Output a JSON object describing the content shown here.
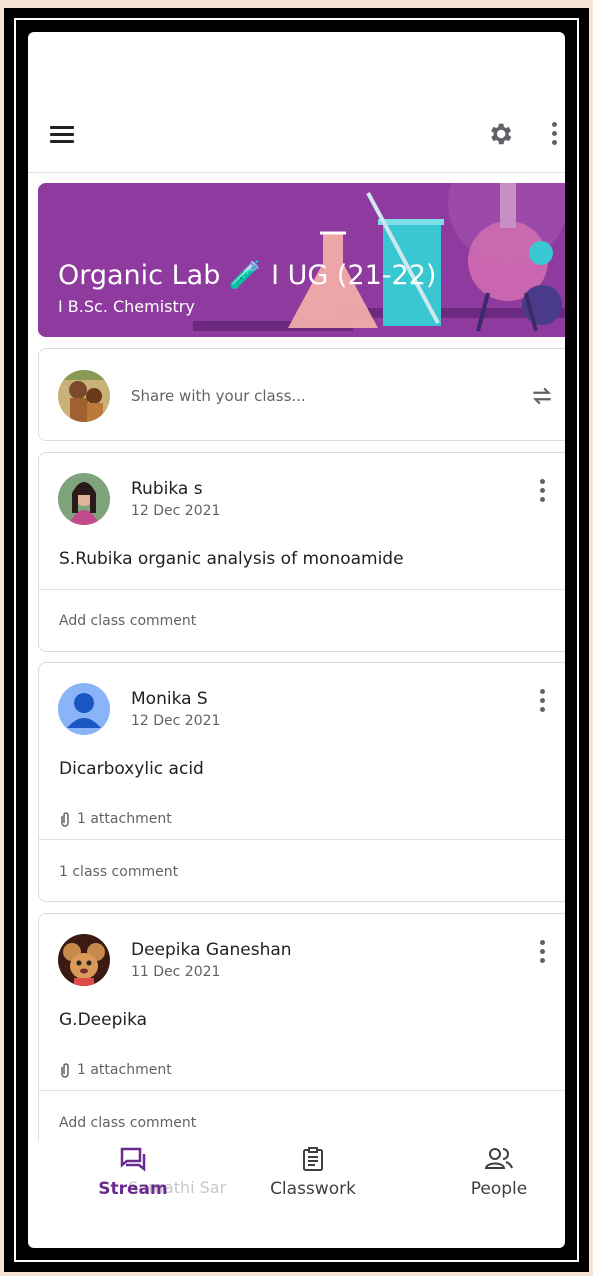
{
  "topbar": {
    "menu_icon": "hamburger-menu-icon",
    "settings_icon": "gear-icon",
    "more_icon": "more-vert-icon"
  },
  "banner": {
    "title": "Organic Lab 🧪 I UG (21-22)",
    "subtitle": "I B.Sc. Chemistry",
    "color": "#8e3a9e"
  },
  "share": {
    "placeholder": "Share with your class...",
    "repost_icon": "repost-icon"
  },
  "posts": [
    {
      "author": "Rubika s",
      "date": "12 Dec 2021",
      "body": "S.Rubika organic analysis of monoamide",
      "attachment": "",
      "comment": "Add class comment"
    },
    {
      "author": "Monika S",
      "date": "12 Dec 2021",
      "body": "Dicarboxylic acid",
      "attachment": "1 attachment",
      "comment": "1 class comment"
    },
    {
      "author": "Deepika Ganeshan",
      "date": "11 Dec 2021",
      "body": "G.Deepika",
      "attachment": "1 attachment",
      "comment": "Add class comment"
    }
  ],
  "peek_author": "Sumathi Sar",
  "nav": [
    {
      "label": "Stream",
      "icon": "stream-icon",
      "active": true
    },
    {
      "label": "Classwork",
      "icon": "classwork-icon",
      "active": false
    },
    {
      "label": "People",
      "icon": "people-icon",
      "active": false
    }
  ],
  "colors": {
    "accent": "#6a2a8f",
    "text": "#202124",
    "muted": "#5f6368"
  }
}
